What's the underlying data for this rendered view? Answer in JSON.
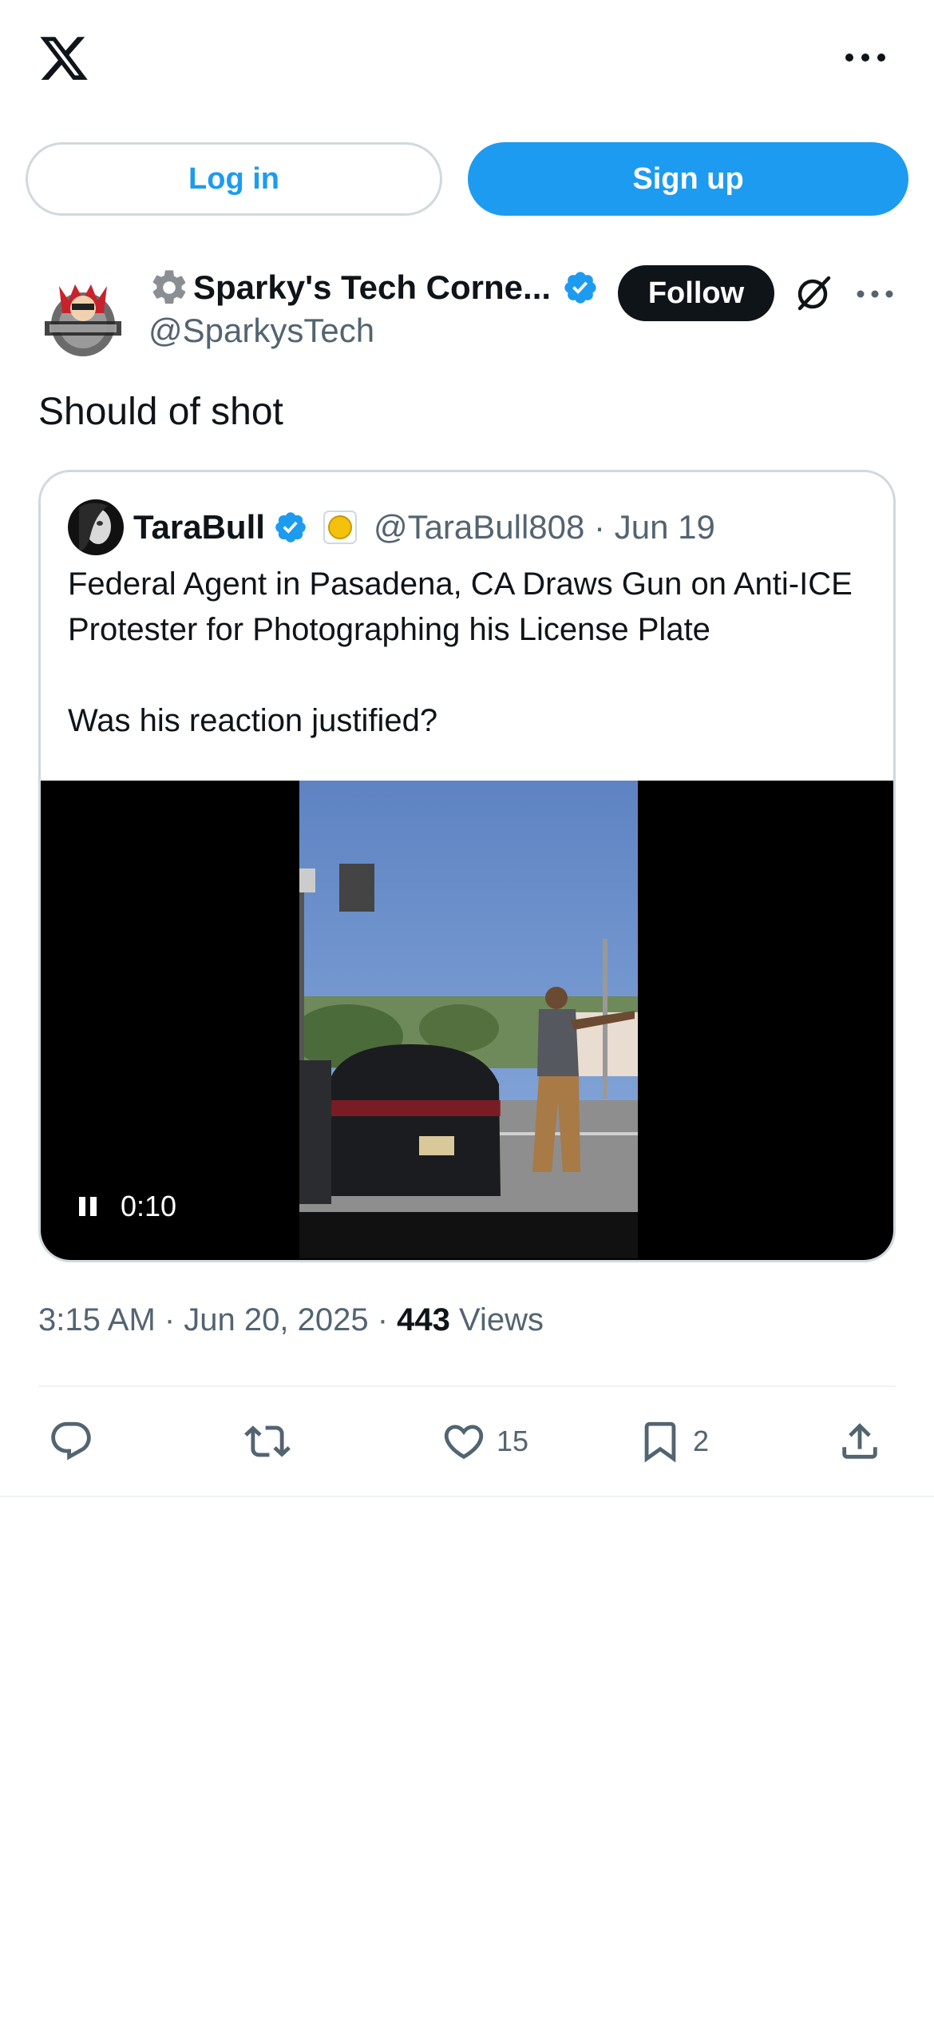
{
  "colors": {
    "accent": "#1d9bf0",
    "text_primary": "#0f1419",
    "text_secondary": "#536471",
    "border": "#cfd9de"
  },
  "topbar": {
    "logo": "x-logo-icon",
    "more": "more-horizontal-icon"
  },
  "auth": {
    "login_label": "Log in",
    "signup_label": "Sign up"
  },
  "post": {
    "author_name": "Sparky's Tech Corne...",
    "author_handle": "@SparkysTech",
    "follow_label": "Follow",
    "text": "Should of shot",
    "timestamp": "3:15 AM · Jun 20, 2025 · ",
    "views_count": "443",
    "views_label": " Views"
  },
  "quote": {
    "author_name": "TaraBull",
    "author_handle": "@TaraBull808 · Jun 19",
    "text_line1": "Federal Agent in Pasadena, CA Draws Gun on Anti-ICE Protester for Photographing his License Plate",
    "text_line2": "Was his reaction justified?",
    "video_time": "0:10"
  },
  "actions": {
    "reply": {
      "icon": "reply-icon",
      "count": ""
    },
    "repost": {
      "icon": "repost-icon",
      "count": ""
    },
    "like": {
      "icon": "heart-icon",
      "count": "15"
    },
    "bookmark": {
      "icon": "bookmark-icon",
      "count": "2"
    },
    "share": {
      "icon": "share-icon"
    }
  }
}
